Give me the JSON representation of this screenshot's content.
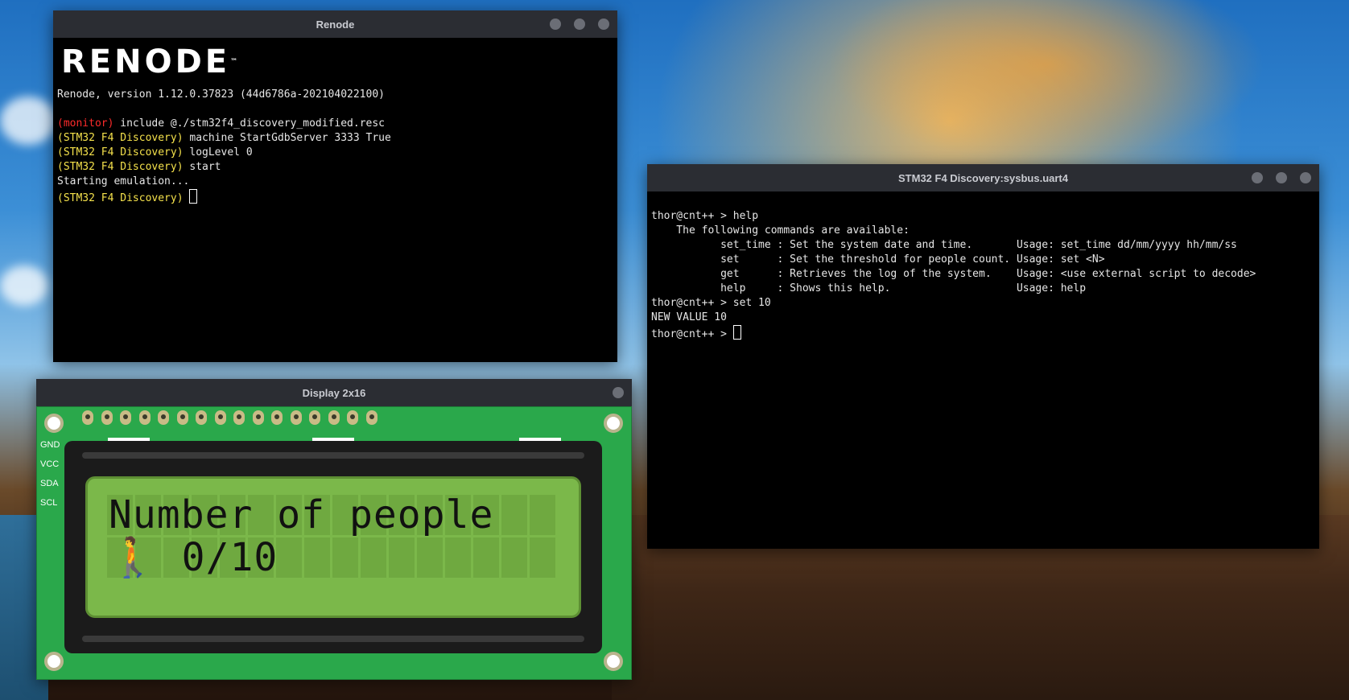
{
  "renode_window": {
    "title": "Renode",
    "logo": "RENODE",
    "logo_tm": "™",
    "version_line": "Renode, version 1.12.0.37823 (44d6786a-202104022100)",
    "lines": [
      {
        "prompt": "(monitor)",
        "prompt_color": "#ff2b2b",
        "cmd": " include @./stm32f4_discovery_modified.resc"
      },
      {
        "prompt": "(STM32 F4 Discovery)",
        "prompt_color": "#f4e14b",
        "cmd": " machine StartGdbServer 3333 True"
      },
      {
        "prompt": "(STM32 F4 Discovery)",
        "prompt_color": "#f4e14b",
        "cmd": " logLevel 0"
      },
      {
        "prompt": "(STM32 F4 Discovery)",
        "prompt_color": "#f4e14b",
        "cmd": " start"
      }
    ],
    "status": "Starting emulation...",
    "current_prompt": "(STM32 F4 Discovery)"
  },
  "uart_window": {
    "title": "STM32 F4 Discovery:sysbus.uart4",
    "lines": [
      "thor@cnt++ > help",
      "    The following commands are available:",
      "           set_time : Set the system date and time.       Usage: set_time dd/mm/yyyy hh/mm/ss",
      "           set      : Set the threshold for people count. Usage: set <N>",
      "           get      : Retrieves the log of the system.    Usage: <use external script to decode>",
      "           help     : Shows this help.                    Usage: help",
      "thor@cnt++ > set 10",
      "NEW VALUE 10"
    ],
    "prompt": "thor@cnt++ > "
  },
  "display_window": {
    "title": "Display 2x16",
    "pin_labels": [
      "GND",
      "VCC",
      "SDA",
      "SCL"
    ],
    "lcd_line1": "Number of people",
    "lcd_line2": "🚶 0/10"
  }
}
